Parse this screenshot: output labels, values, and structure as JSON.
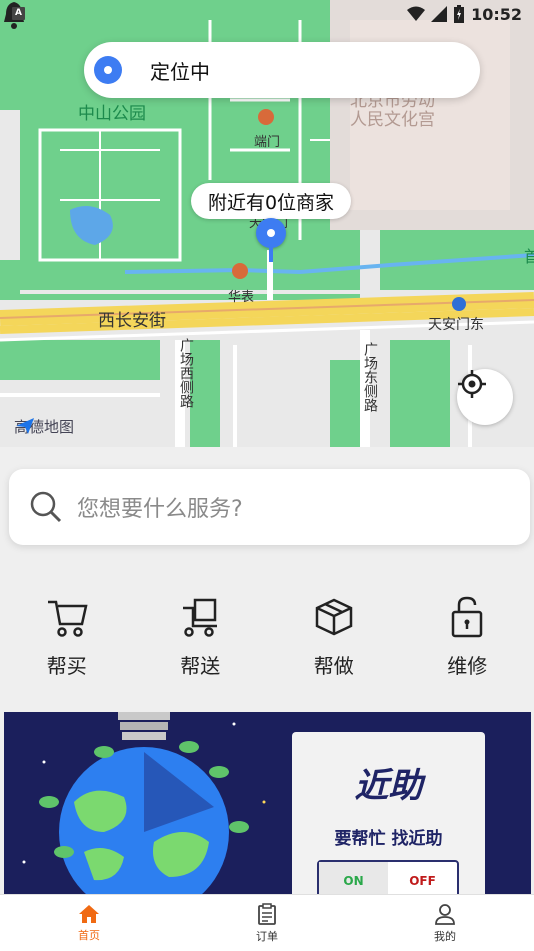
{
  "status_bar": {
    "time": "10:52",
    "app_badge": "A"
  },
  "map": {
    "labels": {
      "park": "中山公园",
      "palace": "北京市劳动\n人民文化宫",
      "gate1": "端门",
      "gate2": "天安门",
      "huabiao": "华表",
      "street": "西长安街",
      "metro": "天安门东",
      "road_west": "广场西侧路",
      "road_east": "广场东侧路",
      "edge": "首"
    },
    "logo_text": "高德地图"
  },
  "location_pill": {
    "text": "定位中"
  },
  "nearby_bubble": {
    "text": "附近有0位商家"
  },
  "search": {
    "placeholder": "您想要什么服务?"
  },
  "services": [
    {
      "label": "帮买",
      "icon": "cart-icon"
    },
    {
      "label": "帮送",
      "icon": "truck-icon"
    },
    {
      "label": "帮做",
      "icon": "box-icon"
    },
    {
      "label": "维修",
      "icon": "lock-icon"
    }
  ],
  "banner": {
    "title": "近助",
    "subtitle": "要帮忙  找近助",
    "switch_on": "ON",
    "switch_off": "OFF"
  },
  "tabbar": [
    {
      "label": "首页",
      "icon": "home-icon",
      "active": true
    },
    {
      "label": "订单",
      "icon": "clipboard-icon",
      "active": false
    },
    {
      "label": "我的",
      "icon": "user-icon",
      "active": false
    }
  ],
  "colors": {
    "accent": "#f06a13",
    "map_green": "#6fd08c",
    "pin_blue": "#3d7cf2",
    "banner_bg": "#1b1f5c"
  }
}
